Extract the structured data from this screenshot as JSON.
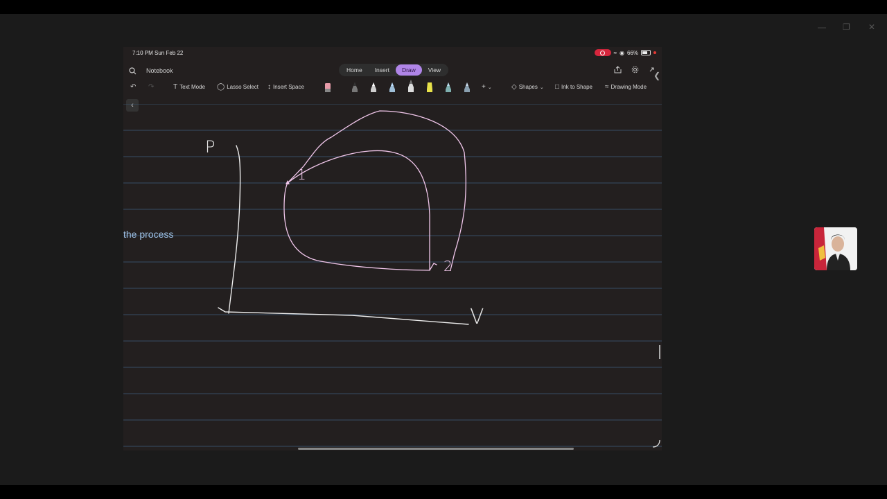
{
  "status": {
    "time": "7:10 PM  Sun Feb 22",
    "battery": "66%"
  },
  "header": {
    "notebook": "Notebook",
    "tabs": [
      "Home",
      "Insert",
      "Draw",
      "View"
    ]
  },
  "toolbar": {
    "text_mode": "Text Mode",
    "lasso_select": "Lasso Select",
    "insert_space": "Insert Space",
    "shapes": "Shapes",
    "ink_to_shape": "Ink to Shape",
    "drawing_mode": "Drawing Mode"
  },
  "page": {
    "label_text": "the process",
    "axis_y": "P",
    "axis_x": "V",
    "point_1": "1",
    "point_2": "2"
  },
  "colors": {
    "accent": "#b085e8",
    "ink": "#e8e8e8",
    "rule_line": "#3c5a78",
    "label": "#9fc3e8"
  }
}
